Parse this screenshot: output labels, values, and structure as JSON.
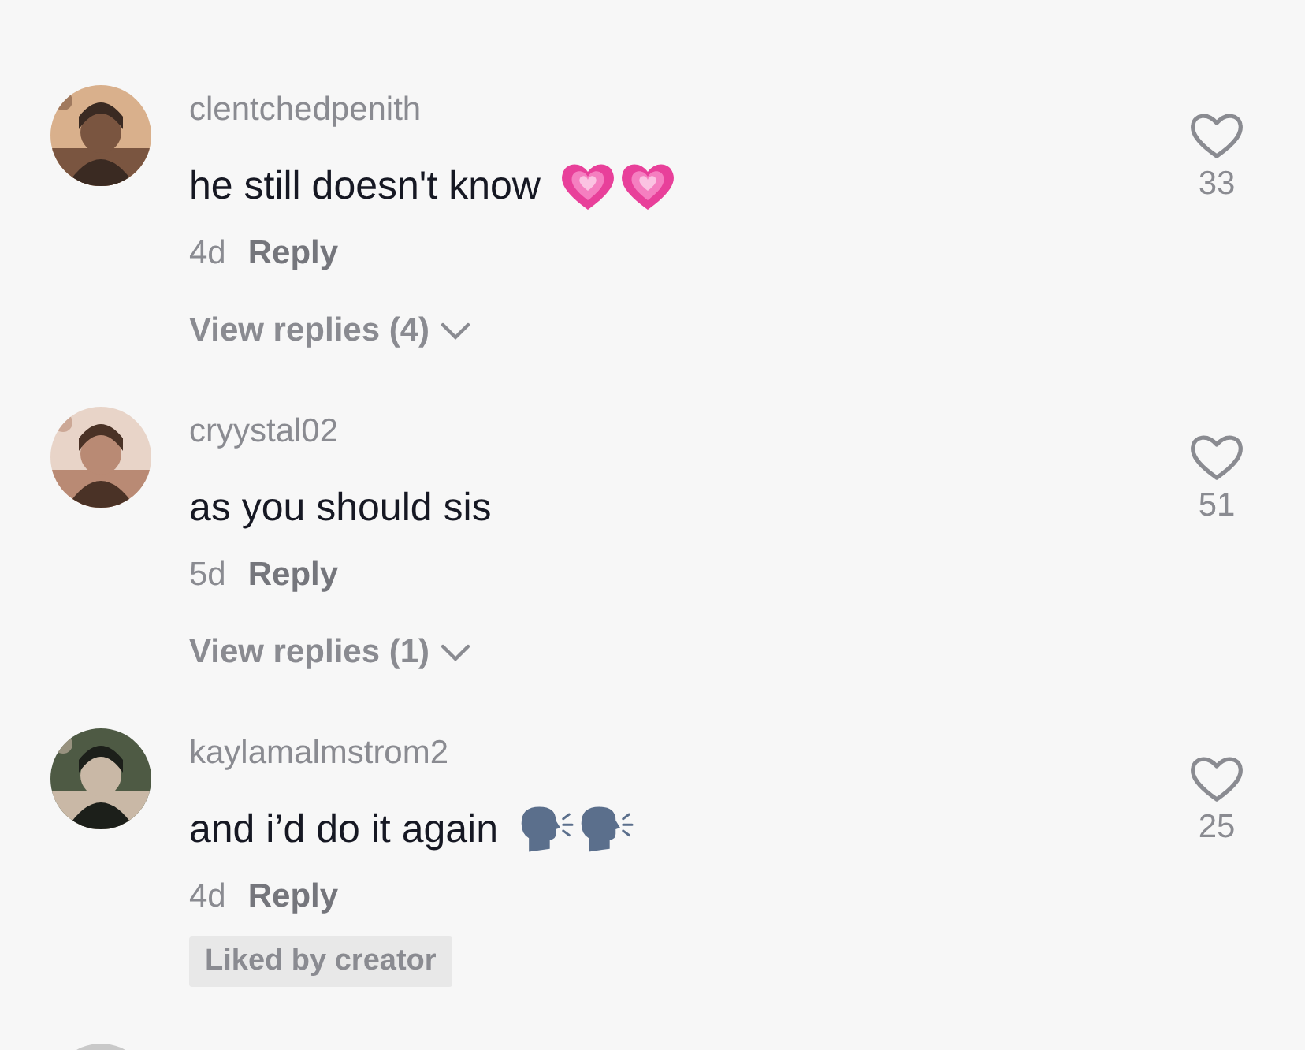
{
  "comments": [
    {
      "username": "clentchedpenith",
      "text": "he still doesn't know",
      "emojis": [
        {
          "kind": "growing_heart"
        },
        {
          "kind": "growing_heart"
        }
      ],
      "age": "4d",
      "reply": "Reply",
      "view_replies": "View replies (4)",
      "likes": "33",
      "liked": false
    },
    {
      "username": "cryystal02",
      "text": "as you should sis",
      "age": "5d",
      "reply": "Reply",
      "view_replies": "View replies (1)",
      "likes": "51",
      "liked": false
    },
    {
      "username": "kaylamalmstrom2",
      "text": "and i’d do it again",
      "emojis": [
        {
          "kind": "speaking_head"
        },
        {
          "kind": "speaking_head"
        }
      ],
      "age": "4d",
      "reply": "Reply",
      "tag": "Liked by creator",
      "likes": "25",
      "liked": false
    }
  ]
}
